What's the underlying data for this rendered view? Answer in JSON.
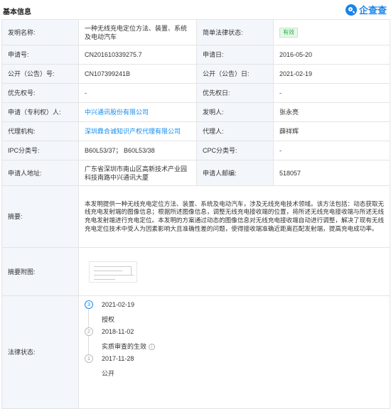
{
  "header": {
    "title": "基本信息",
    "brand": "企查查"
  },
  "rows": {
    "invention_name_label": "发明名称:",
    "invention_name": "一种无线充电定位方法、装置、系统及电动汽车",
    "legal_status_label": "简单法律状态:",
    "legal_status_badge": "有效",
    "app_no_label": "申请号:",
    "app_no": "CN201610339275.7",
    "app_date_label": "申请日:",
    "app_date": "2016-05-20",
    "pub_no_label": "公开（公告）号:",
    "pub_no": "CN107399241B",
    "pub_date_label": "公开（公告）日:",
    "pub_date": "2021-02-19",
    "priority_no_label": "优先权号:",
    "priority_no": "-",
    "priority_date_label": "优先权日:",
    "priority_date": "-",
    "applicant_label": "申请（专利权）人:",
    "applicant": "中兴通讯股份有限公司",
    "inventor_label": "发明人:",
    "inventor": "张永亮",
    "agency_label": "代理机构:",
    "agency": "深圳鼎合诚知识产权代理有限公司",
    "agent_label": "代理人:",
    "agent": "薛祥辉",
    "ipc_label": "IPC分类号:",
    "ipc": "B60L53/37；  B60L53/38",
    "cpc_label": "CPC分类号:",
    "cpc": "-",
    "address_label": "申请人地址:",
    "address": "广东省深圳市南山区高新技术产业园科技南路中兴通讯大厦",
    "postcode_label": "申请人邮编:",
    "postcode": "518057",
    "abstract_label": "摘要:",
    "abstract": "本发明提供一种无线充电定位方法、装置、系统及电动汽车，涉及无线充电技术领域。该方法包括：动态获取无线充电发射端的图像信息；根据所述图像信息，调整无线充电接收端的位置，将所述无线充电接收端与所述无线充电发射端进行充电定位。本发明的方案通过动态的图像信息对无线充电接收端自动进行调整，解决了现有无线充电定位技术中受人为因素影响大且准确性差的问题，使得接收端准确近距离匹配发射端，提高充电成功率。",
    "drawing_label": "摘要附图:",
    "legal_label": "法律状态:"
  },
  "legal_events": [
    {
      "num": "3",
      "date": "2021-02-19",
      "event": "授权"
    },
    {
      "num": "2",
      "date": "2018-11-02",
      "event": "实质审查的生效"
    },
    {
      "num": "1",
      "date": "2017-11-28",
      "event": "公开"
    }
  ],
  "colors": {
    "accent": "#128bed",
    "label_bg": "#f3f6fb",
    "badge_green": "#2ab14b"
  },
  "icons": {
    "brand": "magnifier-logo-icon",
    "info": "info-icon"
  }
}
